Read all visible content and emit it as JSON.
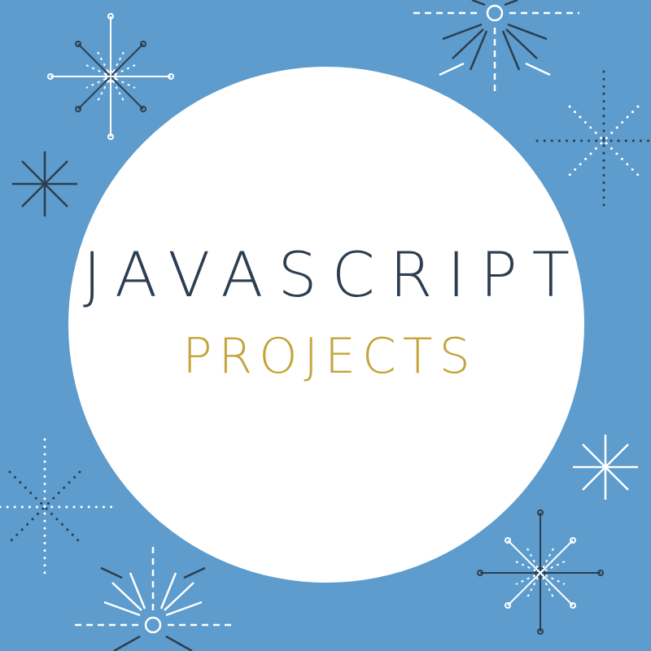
{
  "title": "JAVASCRIPT",
  "subtitle": "PROJECTS",
  "colors": {
    "background": "#5d9ccc",
    "circle": "#ffffff",
    "title": "#2c3e50",
    "subtitle": "#c4a43a",
    "star_dark": "#2c3e50",
    "star_light": "#ffffff"
  },
  "decorations": [
    "burst-star-icon",
    "firework-icon",
    "dotted-star-icon",
    "asterisk-icon",
    "sparkle-icon",
    "starburst-icon"
  ]
}
